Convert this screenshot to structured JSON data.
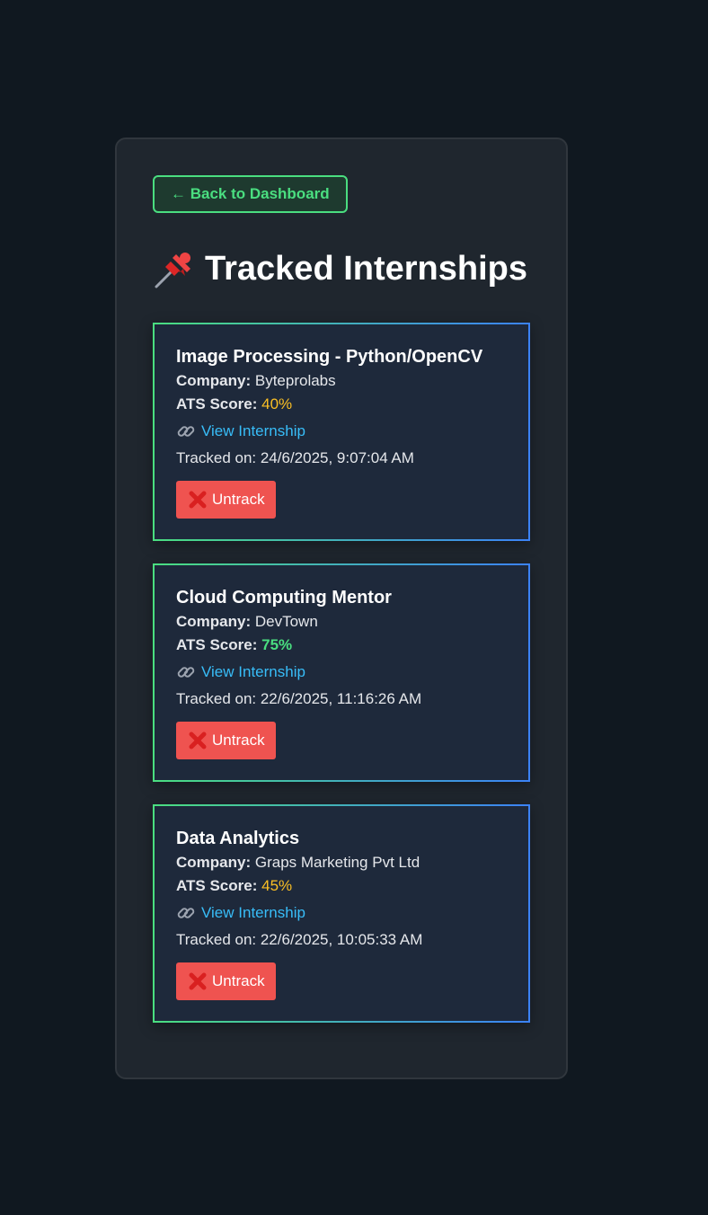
{
  "nav": {
    "back_label": "← Back to Dashboard"
  },
  "page": {
    "title": "Tracked Internships",
    "title_icon": "pushpin-icon"
  },
  "labels": {
    "company": "Company:",
    "ats": "ATS Score:",
    "view": "View Internship",
    "untrack": "Untrack"
  },
  "colors": {
    "accent_green": "#4ade80",
    "accent_blue": "#3b82f6",
    "link": "#38bdf8",
    "score_mid": "#fbbf24",
    "untrack_bg": "#ef5350"
  },
  "internships": [
    {
      "title": "Image Processing - Python/OpenCV",
      "company": "Byteprolabs",
      "ats": "40%",
      "tracked": "Tracked on: 24/6/2025, 9:07:04 AM"
    },
    {
      "title": "Cloud Computing Mentor",
      "company": "DevTown",
      "ats": "75%",
      "tracked": "Tracked on: 22/6/2025, 11:16:26 AM"
    },
    {
      "title": "Data Analytics",
      "company": "Graps Marketing Pvt Ltd",
      "ats": "45%",
      "tracked": "Tracked on: 22/6/2025, 10:05:33 AM"
    }
  ]
}
